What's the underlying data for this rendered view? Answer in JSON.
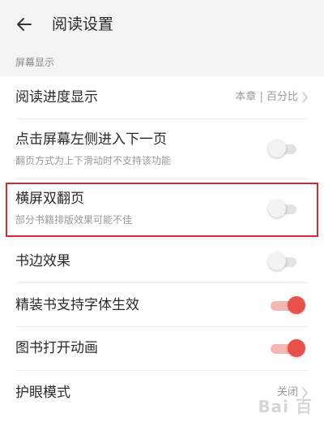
{
  "header": {
    "title": "阅读设置",
    "back_icon": "arrow-left-icon"
  },
  "section": {
    "label": "屏幕显示"
  },
  "rows": [
    {
      "title": "阅读进度显示",
      "value": "本章 | 百分比",
      "type": "link"
    },
    {
      "title": "点击屏幕左侧进入下一页",
      "subtitle": "翻页方式为上下滑动时不支持该功能",
      "type": "toggle",
      "on": false
    },
    {
      "title": "横屏双翻页",
      "subtitle": "部分书籍排版效果可能不佳",
      "type": "toggle",
      "on": false
    },
    {
      "title": "书边效果",
      "type": "toggle",
      "on": false
    },
    {
      "title": "精装书支持字体生效",
      "type": "toggle",
      "on": true
    },
    {
      "title": "图书打开动画",
      "type": "toggle",
      "on": true
    },
    {
      "title": "护眼模式",
      "value": "关闭",
      "type": "link"
    }
  ],
  "colors": {
    "accent": "#e8504a",
    "highlight_border": "#d42a31"
  },
  "watermark": "Bai 百"
}
